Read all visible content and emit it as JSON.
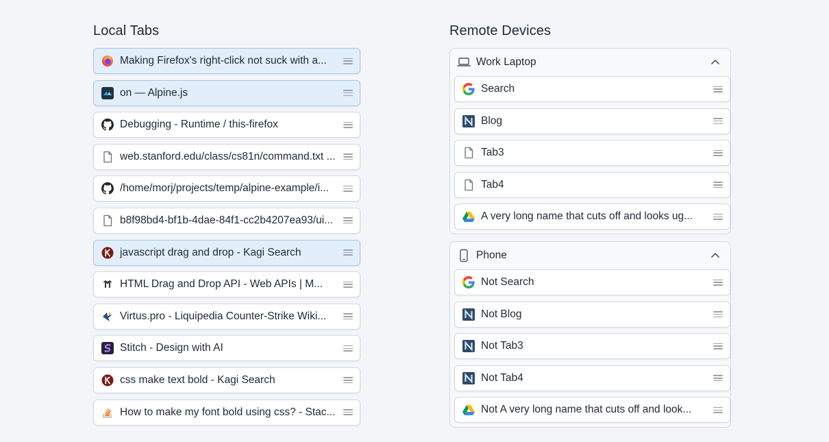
{
  "local": {
    "title": "Local Tabs",
    "tabs": [
      {
        "label": "Making Firefox's right-click not suck with a...",
        "icon": "firefox-icon",
        "selected": true
      },
      {
        "label": "on — Alpine.js",
        "icon": "alpine-icon",
        "selected": true
      },
      {
        "label": "Debugging - Runtime / this-firefox",
        "icon": "github-icon",
        "selected": false
      },
      {
        "label": "web.stanford.edu/class/cs81n/command.txt ...",
        "icon": "page-icon",
        "selected": false
      },
      {
        "label": "/home/morj/projects/temp/alpine-example/i...",
        "icon": "github-icon",
        "selected": false
      },
      {
        "label": "b8f98bd4-bf1b-4dae-84f1-cc2b4207ea93/ui...",
        "icon": "page-icon",
        "selected": false
      },
      {
        "label": "javascript drag and drop - Kagi Search",
        "icon": "kagi-icon",
        "selected": true
      },
      {
        "label": "HTML Drag and Drop API - Web APIs | M...",
        "icon": "mdn-icon",
        "selected": false
      },
      {
        "label": "Virtus.pro - Liquipedia Counter-Strike Wiki...",
        "icon": "liquipedia-icon",
        "selected": false
      },
      {
        "label": "Stitch - Design with AI",
        "icon": "stitch-icon",
        "selected": false
      },
      {
        "label": "css make text bold - Kagi Search",
        "icon": "kagi-icon",
        "selected": false
      },
      {
        "label": "How to make my font bold using css? - Stac...",
        "icon": "stackoverflow-icon",
        "selected": false
      }
    ]
  },
  "remote": {
    "title": "Remote Devices",
    "devices": [
      {
        "name": "Work Laptop",
        "icon": "laptop-icon",
        "tabs": [
          {
            "label": "Search",
            "icon": "google-icon"
          },
          {
            "label": "Blog",
            "icon": "n-icon"
          },
          {
            "label": "Tab3",
            "icon": "page-icon"
          },
          {
            "label": "Tab4",
            "icon": "page-icon"
          },
          {
            "label": "A very long name that cuts off and looks ug...",
            "icon": "drive-icon"
          }
        ]
      },
      {
        "name": "Phone",
        "icon": "phone-icon",
        "tabs": [
          {
            "label": "Not Search",
            "icon": "google-icon"
          },
          {
            "label": "Not Blog",
            "icon": "n-icon"
          },
          {
            "label": "Not Tab3",
            "icon": "n-icon"
          },
          {
            "label": "Not Tab4",
            "icon": "n-icon"
          },
          {
            "label": "Not A very long name that cuts off and look...",
            "icon": "drive-icon"
          }
        ]
      }
    ]
  },
  "colors": {
    "selected_bg": "#e3eefb",
    "selected_border": "#a9c4e2",
    "card_border": "#d3d9e1"
  }
}
